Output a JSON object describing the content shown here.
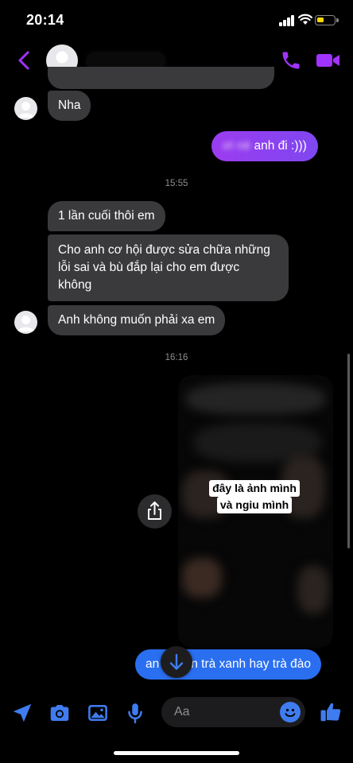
{
  "status_bar": {
    "time": "20:14"
  },
  "header": {
    "contact_name": "",
    "back_icon": "chevron-left-icon",
    "call_icon": "phone-icon",
    "video_icon": "video-camera-icon",
    "accent_color": "#a033ff"
  },
  "messages": {
    "nha": "Nha",
    "sent_1": "anh đi :)))",
    "sent_1_blurred": "ơi nè",
    "timestamp_1": "15:55",
    "recv_1": "1 lần cuối thôi em",
    "recv_2_line1": "Cho anh cơ hội được sửa chữa những",
    "recv_2_line2": "lỗi sai và bù đắp lại cho em được",
    "recv_2_line3": "không",
    "recv_3": "Anh không muốn phải xa em",
    "timestamp_2": "16:16",
    "media_caption_line1": "đây là ảnh mình",
    "media_caption_line2": "và ngiu mình",
    "sent_2_start": "an",
    "sent_2_end": "n trà xanh hay trà đào"
  },
  "composer": {
    "placeholder": "Aa",
    "tools": [
      "location-arrow-icon",
      "camera-icon",
      "gallery-icon",
      "microphone-icon"
    ],
    "emoji_icon": "emoji-icon",
    "like_icon": "thumbs-up-icon",
    "tool_color": "#3f7cf0"
  },
  "colors": {
    "sent_bubble_top": "#8a3cf0",
    "sent_bubble_bottom": "#2a6ff0",
    "received_bubble": "#3a3a3c"
  }
}
